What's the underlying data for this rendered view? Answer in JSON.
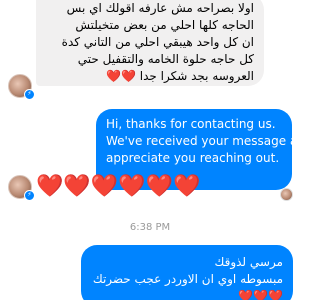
{
  "messages": {
    "incoming_1": {
      "lines": [
        "اولا بصراحه مش عارفه اقولك اي بس",
        "الحاجه كلها احلي من بعض متخيلتش",
        "ان كل واحد هيبقي احلي من التاني كدة",
        "كل حاجه حلوة الخامه والتقفيل حتي",
        "العروسه بجد شكرا جدا"
      ],
      "trailing_emoji": "❤️❤️"
    },
    "outgoing_1": {
      "lines": [
        "Hi, thanks for contacting us.",
        "We've received your message and",
        "appreciate you reaching out."
      ]
    },
    "incoming_hearts": "❤️❤️❤️❤️❤️❤️",
    "timestamp": "6:38 PM",
    "outgoing_2": {
      "lines": [
        "مرسي لذوقك",
        "مبسوطه اوي ان الاوردر عجب حضرتك",
        "❤️❤️❤️"
      ]
    }
  },
  "colors": {
    "incoming_bubble": "#f1f0f0",
    "outgoing_bubble": "#0084ff",
    "heart": "#e0241f",
    "timestamp": "#9a9a9a"
  },
  "icons": [
    "user-avatar",
    "messenger-badge-icon",
    "read-receipt-avatar"
  ]
}
